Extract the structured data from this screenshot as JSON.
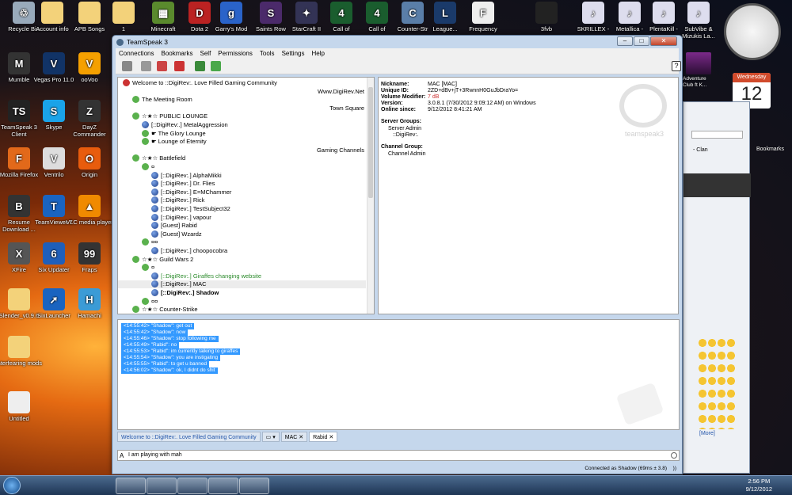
{
  "desktop": {
    "icons": [
      {
        "label": "Recycle Bin",
        "glyph": "♲"
      },
      {
        "label": "Account info",
        "glyph": ""
      },
      {
        "label": "APB Songs",
        "glyph": ""
      },
      {
        "label": "1",
        "glyph": ""
      },
      {
        "label": "Minecraft",
        "glyph": "▦"
      },
      {
        "label": "Dota 2",
        "glyph": "D"
      },
      {
        "label": "Garry's Mod",
        "glyph": "g"
      },
      {
        "label": "Saints Row",
        "glyph": "S"
      },
      {
        "label": "StarCraft II",
        "glyph": "✦"
      },
      {
        "label": "Call of",
        "glyph": "4"
      },
      {
        "label": "Call of",
        "glyph": "4"
      },
      {
        "label": "Counter-Str",
        "glyph": "C"
      },
      {
        "label": "League...",
        "glyph": "L"
      },
      {
        "label": "Frequency",
        "glyph": "F"
      },
      {
        "label": "3fvb",
        "glyph": ""
      },
      {
        "label": "SKRILLEX -",
        "glyph": "♪"
      },
      {
        "label": "Metallica -",
        "glyph": "♪"
      },
      {
        "label": "PlentaKill -",
        "glyph": "♪"
      },
      {
        "label": "SubVibe & Mizukis La...",
        "glyph": "♪"
      },
      {
        "label": "Mumble",
        "glyph": "M"
      },
      {
        "label": "Vegas Pro 11.0",
        "glyph": "V"
      },
      {
        "label": "ooVoo",
        "glyph": "V"
      },
      {
        "label": "TeamSpeak 3 Client",
        "glyph": "TS"
      },
      {
        "label": "Skype",
        "glyph": "S"
      },
      {
        "label": "DayZ Commander",
        "glyph": "Z"
      },
      {
        "label": "Mozilla Firefox",
        "glyph": "F"
      },
      {
        "label": "Ventrilo",
        "glyph": "V"
      },
      {
        "label": "Origin",
        "glyph": "O"
      },
      {
        "label": "Resume Download ...",
        "glyph": "B"
      },
      {
        "label": "TeamViewer 7",
        "glyph": "T"
      },
      {
        "label": "VLC media player",
        "glyph": "▲"
      },
      {
        "label": "XFire",
        "glyph": "X"
      },
      {
        "label": "Six Updater",
        "glyph": "6"
      },
      {
        "label": "Fraps",
        "glyph": "99"
      },
      {
        "label": "Slender_v0.9.6",
        "glyph": ""
      },
      {
        "label": "SixLauncher",
        "glyph": "➚"
      },
      {
        "label": "Hamachi",
        "glyph": "H"
      },
      {
        "label": "interfearing mods",
        "glyph": ""
      },
      {
        "label": "Untitled",
        "glyph": ""
      }
    ]
  },
  "gadgets": {
    "calendar_day": "Wednesday",
    "adventure": "Adventure Club ft K..."
  },
  "browser_partial": {
    "clan": "- Clan",
    "bookmarks": "Bookmarks",
    "more": "[More]"
  },
  "teamspeak": {
    "title": "TeamSpeak 3",
    "menu": [
      "Connections",
      "Bookmarks",
      "Self",
      "Permissions",
      "Tools",
      "Settings",
      "Help"
    ],
    "server": {
      "name": "Welcome to ::DigiRev:. Love Filled Gaming Community",
      "url": "Www.DigiRev.Net"
    },
    "tree": [
      {
        "indent": 0,
        "type": "server",
        "text": "Welcome to ::DigiRev:. Love Filled Gaming Community",
        "right": ""
      },
      {
        "indent": 0,
        "type": "spacer",
        "text": "",
        "right": "Www.DigiRev.Net"
      },
      {
        "indent": 1,
        "type": "channel",
        "text": "The Meeting Room",
        "right": ""
      },
      {
        "indent": 0,
        "type": "spacer",
        "text": "",
        "right": "Town Square"
      },
      {
        "indent": 1,
        "type": "channel",
        "text": "☆★☆     PUBLIC LOUNGE",
        "right": ""
      },
      {
        "indent": 2,
        "type": "user",
        "text": "[::DigiRev:.] MetalAggression",
        "right": ""
      },
      {
        "indent": 2,
        "type": "channel",
        "text": "☛ The Glory Lounge",
        "right": ""
      },
      {
        "indent": 2,
        "type": "channel",
        "text": "☛ Lounge of Eternity",
        "right": ""
      },
      {
        "indent": 0,
        "type": "spacer",
        "text": "",
        "right": "Gaming Channels"
      },
      {
        "indent": 1,
        "type": "channel",
        "text": "☆★☆ Battlefield",
        "right": ""
      },
      {
        "indent": 2,
        "type": "channel",
        "text": "¤",
        "right": ""
      },
      {
        "indent": 3,
        "type": "user",
        "text": "[::DigiRev:.] AlphaMikki",
        "right": ""
      },
      {
        "indent": 3,
        "type": "user",
        "text": "[::DigiRev:.] Dr. Flies",
        "right": ""
      },
      {
        "indent": 3,
        "type": "user",
        "text": "[::DigiRev:.] E=MChammer",
        "right": ""
      },
      {
        "indent": 3,
        "type": "user",
        "text": "[::DigiRev:.] Rick",
        "right": ""
      },
      {
        "indent": 3,
        "type": "user",
        "text": "[::DigiRev:.] TestSubject32",
        "right": ""
      },
      {
        "indent": 3,
        "type": "user",
        "text": "[::DigiRev:.] vapour",
        "right": ""
      },
      {
        "indent": 3,
        "type": "user",
        "text": "[Guest] Rabid",
        "right": ""
      },
      {
        "indent": 3,
        "type": "user",
        "text": "[Guest] Wzardz",
        "right": ""
      },
      {
        "indent": 2,
        "type": "channel",
        "text": "¤¤",
        "right": ""
      },
      {
        "indent": 3,
        "type": "user",
        "text": "[::DigiRev:.] choopocobra",
        "right": ""
      },
      {
        "indent": 1,
        "type": "channel",
        "text": "☆★☆ Guild Wars 2",
        "right": ""
      },
      {
        "indent": 2,
        "type": "channel",
        "text": "¤",
        "right": ""
      },
      {
        "indent": 3,
        "type": "user-green",
        "text": "[::DigiRev:.] Giraffes changing website",
        "right": ""
      },
      {
        "indent": 3,
        "type": "user-sel",
        "text": "[::DigiRev:.] MAC",
        "right": ""
      },
      {
        "indent": 3,
        "type": "user-bold",
        "text": "[::DigiRev:.] Shadow",
        "right": ""
      },
      {
        "indent": 2,
        "type": "channel",
        "text": "¤¤",
        "right": ""
      },
      {
        "indent": 1,
        "type": "channel",
        "text": "☆★☆ Counter-Strike",
        "right": ""
      }
    ],
    "info": {
      "nickname_label": "Nickname:",
      "nickname": "MAC [MAC]",
      "uid_label": "Unique ID:",
      "uid": "2ZD+dBv+jT+3RwnnH0GuJbDraYo=",
      "volume_label": "Volume Modifier:",
      "volume": "7 dB",
      "version_label": "Version:",
      "version": "3.0.8.1 (7/30/2012 9:09:12 AM) on Windows",
      "online_label": "Online since:",
      "online": "9/12/2012 8:41:21 AM",
      "server_groups_label": "Server Groups:",
      "server_group_1": "Server Admin",
      "server_group_2": "::DigiRev:.",
      "channel_group_label": "Channel Group:",
      "channel_group": "Channel Admin",
      "logo_text": "teamspeak3"
    },
    "chat": [
      "<14:55:42> \"Shadow\": get out",
      "<14:55:42> \"Shadow\": now",
      "<14:55:46> \"Shadow\": stop following me",
      "<14:55:49> \"Rabid\": no",
      "<14:55:53> \"Rabid\": im currently talking to giraffes",
      "<14:55:54> \"Shadow\": you are instigating",
      "<14:55:55> \"Rabid\": to get u banned",
      "<14:56:02> \"Shadow\": ok, I didnt do shit"
    ],
    "tabs": [
      {
        "label": "Welcome to ::DigiRev:. Love Filled Gaming Community"
      },
      {
        "label": ""
      },
      {
        "label": "MAC"
      },
      {
        "label": "Rabid"
      }
    ],
    "input_text": "I am playing with mah",
    "status": "Connected as Shadow (69ms ± 3.8)"
  },
  "taskbar": {
    "time": "2:56 PM",
    "date": "9/12/2012"
  }
}
